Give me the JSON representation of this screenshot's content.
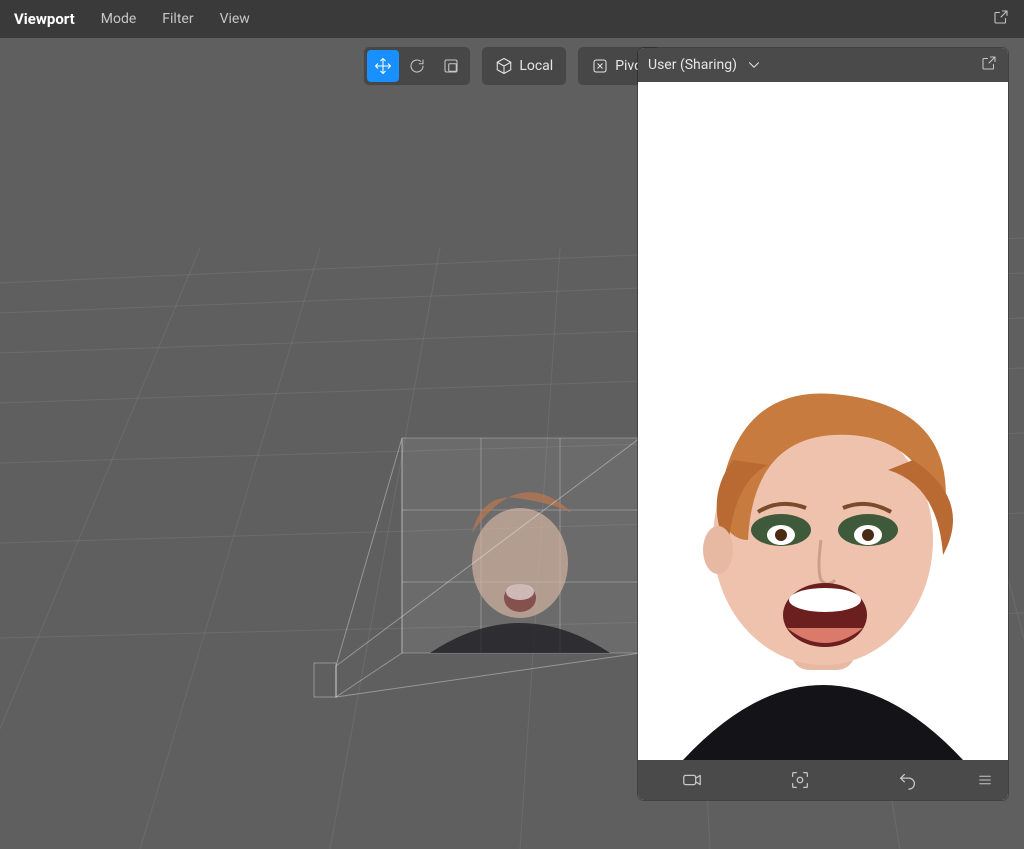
{
  "topbar": {
    "title": "Viewport",
    "menus": [
      "Mode",
      "Filter",
      "View"
    ]
  },
  "toolbar": {
    "transform_tool_active": "move",
    "transform_tools": [
      {
        "name": "move",
        "icon": "move-icon"
      },
      {
        "name": "rotate",
        "icon": "rotate-icon"
      },
      {
        "name": "scale",
        "icon": "scale-icon"
      }
    ],
    "space": {
      "icon": "cube-icon",
      "label": "Local"
    },
    "pivot": {
      "icon": "close-icon",
      "label": "Pivot"
    }
  },
  "share_panel": {
    "title": "User (Sharing)",
    "footer_buttons": [
      {
        "name": "camera",
        "icon": "camera-icon"
      },
      {
        "name": "capture",
        "icon": "capture-icon"
      },
      {
        "name": "reset",
        "icon": "undo-icon"
      },
      {
        "name": "menu",
        "icon": "hamburger-icon"
      }
    ]
  }
}
